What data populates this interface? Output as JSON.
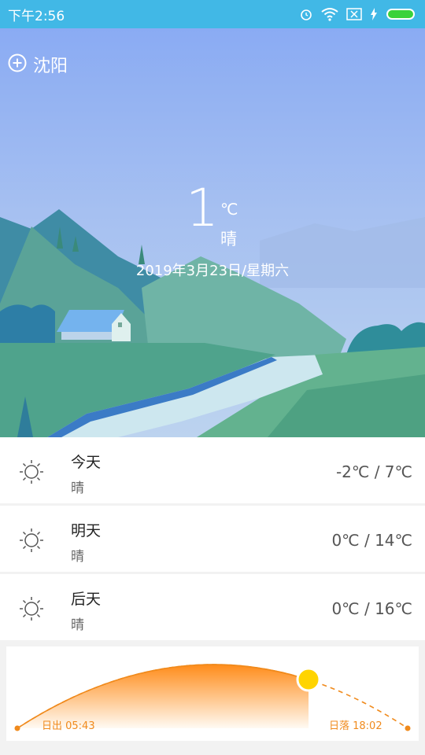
{
  "status_bar": {
    "time": "下午2:56",
    "icons": [
      "alarm-icon",
      "wifi-icon",
      "sim-icon",
      "charging-icon",
      "battery-icon"
    ],
    "color": "#41b8e6"
  },
  "location": {
    "city": "沈阳",
    "add_icon": "plus-circle-icon"
  },
  "current": {
    "temperature": "1",
    "unit": "℃",
    "condition": "晴",
    "date": "2019年3月23日/星期六"
  },
  "forecast": [
    {
      "day": "今天",
      "condition": "晴",
      "range": "-2℃ / 7℃",
      "icon": "sun-icon"
    },
    {
      "day": "明天",
      "condition": "晴",
      "range": "0℃ / 14℃",
      "icon": "sun-icon"
    },
    {
      "day": "后天",
      "condition": "晴",
      "range": "0℃ / 16℃",
      "icon": "sun-icon"
    }
  ],
  "sun": {
    "sunrise": "日出 05:43",
    "sunset": "日落 18:02",
    "accent": "#f08a1c",
    "sun_color": "#ffd400"
  }
}
